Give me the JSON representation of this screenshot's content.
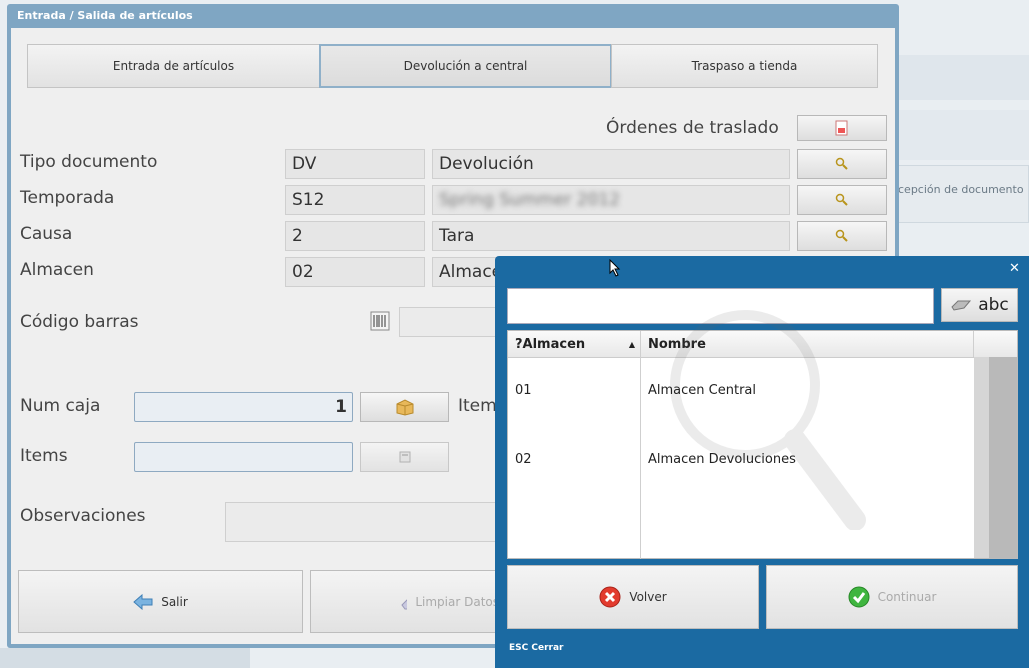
{
  "background": {
    "partial_text": "cepción de documento"
  },
  "window": {
    "title": "Entrada / Salida de artículos"
  },
  "tabs": [
    {
      "label": "Entrada de artículos"
    },
    {
      "label": "Devolución a central"
    },
    {
      "label": "Traspaso a tienda"
    }
  ],
  "ordenes": {
    "label": "Órdenes de traslado"
  },
  "form": {
    "tipo_documento": {
      "label": "Tipo documento",
      "code": "DV",
      "description": "Devolución"
    },
    "temporada": {
      "label": "Temporada",
      "code": "S12",
      "description": "Spring Summer 2012"
    },
    "causa": {
      "label": "Causa",
      "code": "2",
      "description": "Tara"
    },
    "almacen": {
      "label": "Almacen",
      "code": "02",
      "description": "Almacen"
    },
    "codigo_barras": {
      "label": "Código barras"
    },
    "num_caja": {
      "label": "Num caja",
      "value": "1",
      "side_label": "Items"
    },
    "items": {
      "label": "Items"
    },
    "observaciones": {
      "label": "Observaciones"
    }
  },
  "bottom_buttons": {
    "salir": "Salir",
    "limpiar": "Limpiar Datos"
  },
  "dialog": {
    "search_value": "",
    "keyboard_label": "abc",
    "columns": [
      "?Almacen",
      "Nombre"
    ],
    "rows": [
      {
        "code": "01",
        "name": "Almacen Central"
      },
      {
        "code": "02",
        "name": "Almacen Devoluciones"
      }
    ],
    "volver": "Volver",
    "continuar": "Continuar",
    "footer": "ESC Cerrar",
    "close_glyph": "✕"
  },
  "colors": {
    "window_frame": "#7fa6c3",
    "dialog_frame": "#1b6aa2",
    "active_tab_border": "#8fb0c9"
  }
}
